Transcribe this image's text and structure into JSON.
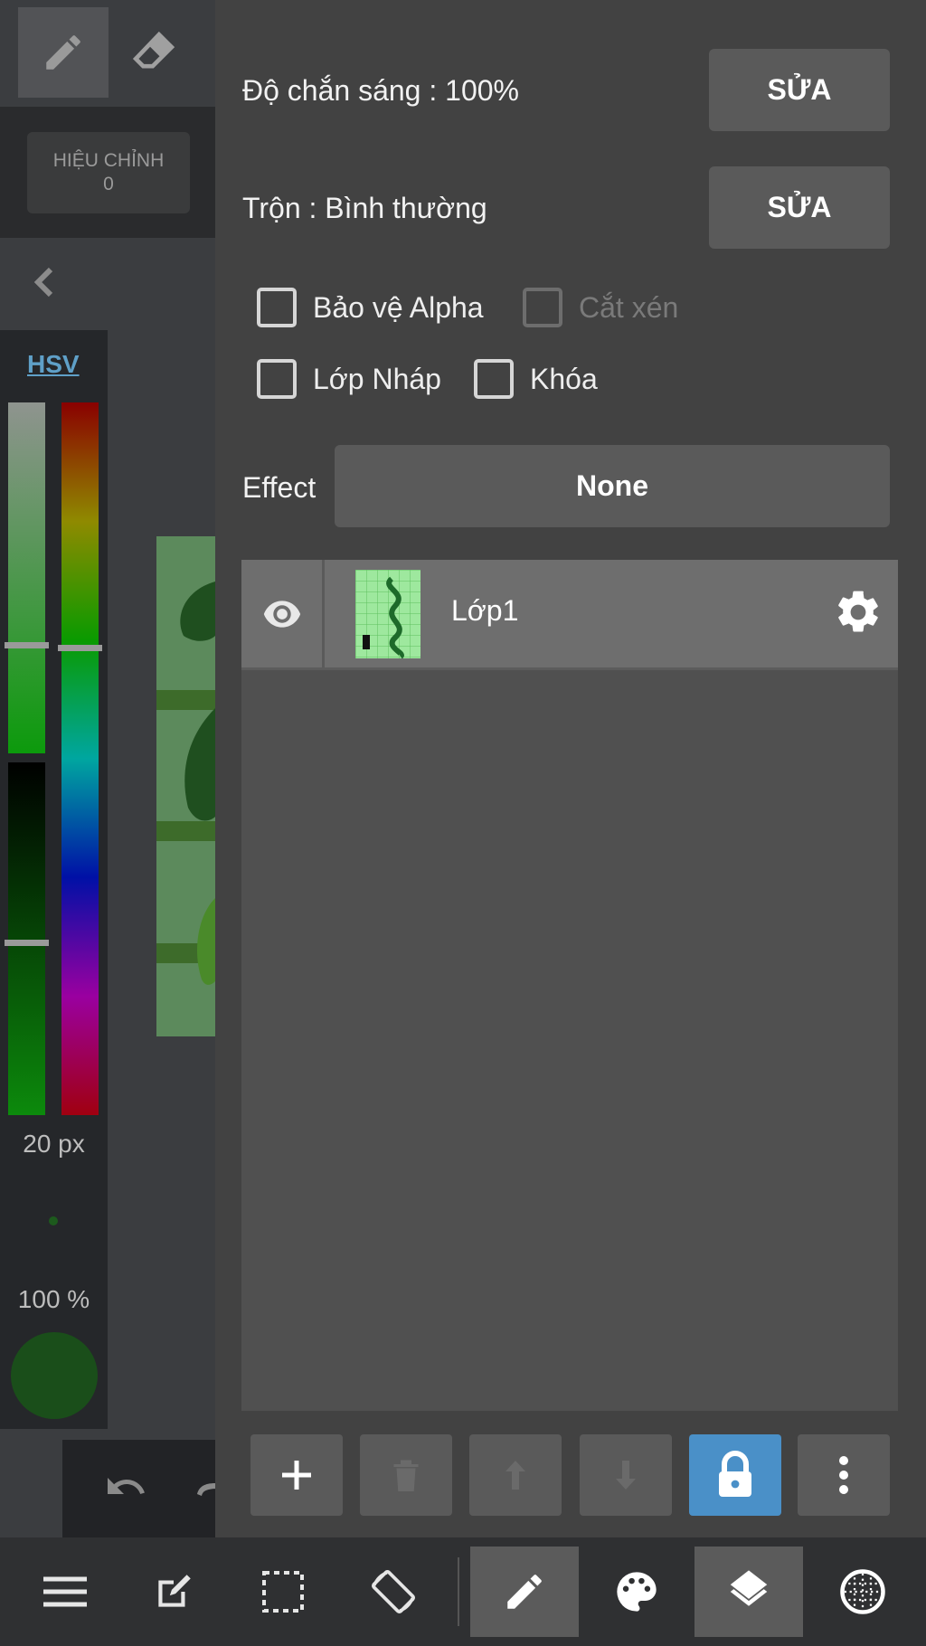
{
  "left_panel": {
    "correction_label": "HIỆU CHỈNH",
    "correction_value": "0",
    "color_mode": "HSV",
    "brush_size": "20 px",
    "brush_opacity": "100 %"
  },
  "layer_panel": {
    "opacity_label": "Độ chắn sáng : 100%",
    "opacity_edit": "SỬA",
    "blend_label": "Trộn : Bình thường",
    "blend_edit": "SỬA",
    "checkboxes": {
      "protect_alpha": "Bảo vệ Alpha",
      "clipping": "Cắt xén",
      "draft_layer": "Lớp Nháp",
      "lock": "Khóa"
    },
    "effect_label": "Effect",
    "effect_value": "None",
    "layers": [
      {
        "name": "Lớp1"
      }
    ]
  },
  "colors": {
    "accent_blue": "#4a90c8",
    "panel_bg": "#424242",
    "list_bg": "#505050",
    "selected_layer": "#6e6e6e"
  }
}
